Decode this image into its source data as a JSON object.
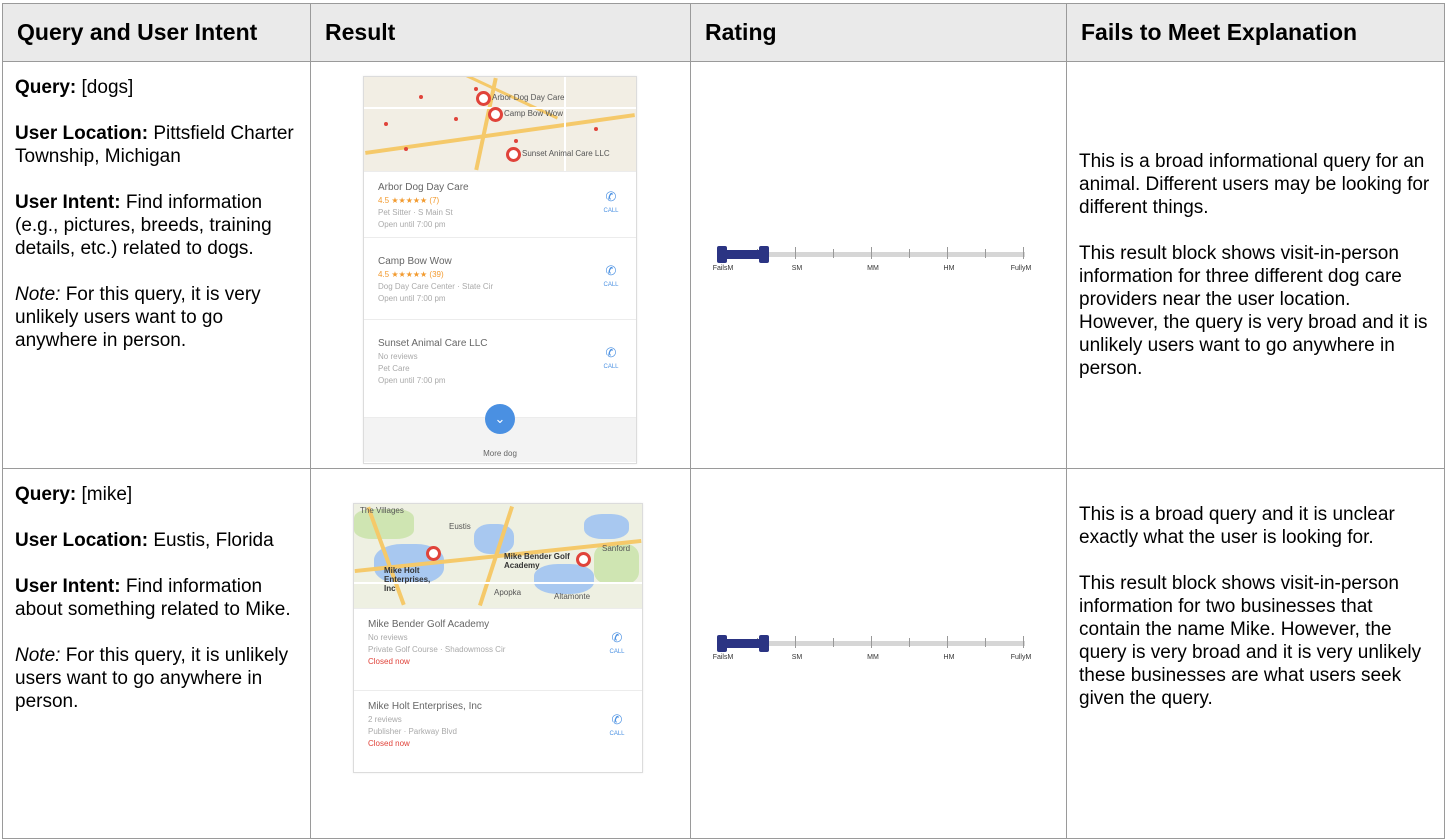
{
  "headers": [
    "Query and User Intent",
    "Result",
    "Rating",
    "Fails to Meet Explanation"
  ],
  "rows": [
    {
      "query_label": "Query:",
      "query": "[dogs]",
      "location_label": "User Location:",
      "location": "Pittsfield Charter Township, Michigan",
      "intent_label": "User Intent:",
      "intent": "Find information (e.g., pictures, breeds, training details, etc.) related to dogs.",
      "note_label": "Note:",
      "note": "For this query, it is very unlikely users want to go anywhere in person.",
      "result": {
        "map_labels": [
          "Arbor Dog Day Care",
          "Camp Bow Wow",
          "Sunset Animal Care LLC"
        ],
        "businesses": [
          {
            "name": "Arbor Dog Day Care",
            "rating": "4.5 ★★★★★ (7)",
            "category": "Pet Sitter · S Main St",
            "hours": "Open until 7:00 pm"
          },
          {
            "name": "Camp Bow Wow",
            "rating": "4.5 ★★★★★ (39)",
            "category": "Dog Day Care Center · State Cir",
            "hours": "Open until 7:00 pm"
          },
          {
            "name": "Sunset Animal Care LLC",
            "rating": "No reviews",
            "category": "Pet Care",
            "hours": "Open until 7:00 pm"
          }
        ],
        "call_label": "CALL",
        "more_label": "More dog"
      },
      "rating": {
        "labels": [
          "FailsM",
          "SM",
          "MM",
          "HM",
          "FullyM"
        ],
        "value": "FailsM",
        "value_fraction": 0.0
      },
      "explanation": [
        "This is a broad informational query for an animal.  Different users may be looking for different things.",
        "This result block shows visit-in-person information for three different dog care providers near the user location.  However, the query is very broad and it is unlikely users want to go anywhere in person."
      ]
    },
    {
      "query_label": "Query:",
      "query": "[mike]",
      "location_label": "User Location:",
      "location": "Eustis, Florida",
      "intent_label": "User Intent:",
      "intent": "Find information about something related to Mike.",
      "note_label": "Note:",
      "note": "For this query, it is unlikely users want to go anywhere in person.",
      "result": {
        "map_labels": [
          "The Villages",
          "Eustis",
          "Mike Holt Enterprises, Inc",
          "Mike Bender Golf Academy",
          "Sanford",
          "Apopka",
          "Altamonte"
        ],
        "businesses": [
          {
            "name": "Mike Bender Golf Academy",
            "rating": "No reviews",
            "category": "Private Golf Course · Shadowmoss Cir",
            "hours": "Closed now"
          },
          {
            "name": "Mike Holt Enterprises, Inc",
            "rating": "2 reviews",
            "category": "Publisher · Parkway Blvd",
            "hours": "Closed now"
          }
        ],
        "call_label": "CALL"
      },
      "rating": {
        "labels": [
          "FailsM",
          "SM",
          "MM",
          "HM",
          "FullyM"
        ],
        "value": "FailsM",
        "value_fraction": 0.0
      },
      "explanation": [
        "This is a broad query and it is unclear exactly what the user is looking for.",
        "This result block shows visit-in-person information for two businesses that contain the name Mike.  However, the query is very broad and it is very unlikely these businesses are what users seek given the query."
      ]
    }
  ]
}
